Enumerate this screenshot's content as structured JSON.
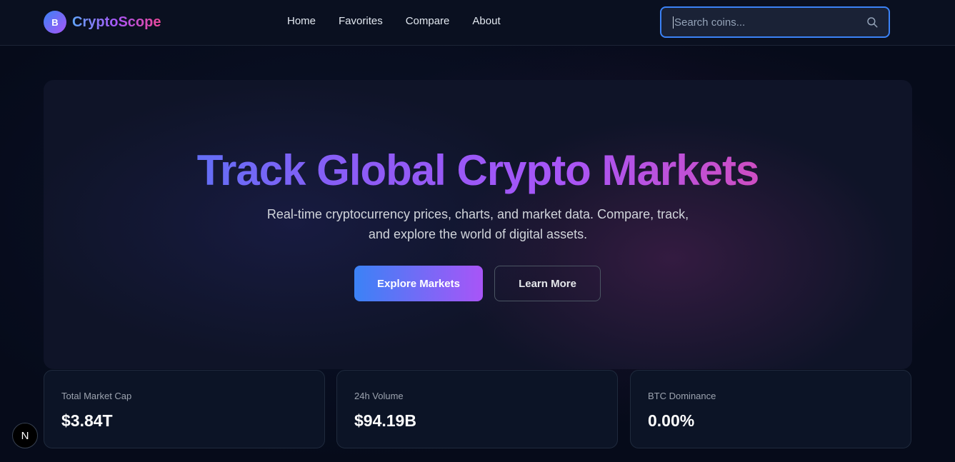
{
  "brand": {
    "logo_glyph": "B",
    "name": "CryptoScope"
  },
  "nav": [
    {
      "label": "Home"
    },
    {
      "label": "Favorites"
    },
    {
      "label": "Compare"
    },
    {
      "label": "About"
    }
  ],
  "search": {
    "placeholder": "Search coins...",
    "value": "",
    "icon": "search-icon"
  },
  "hero": {
    "title": "Track Global Crypto Markets",
    "subtitle_line1": "Real-time cryptocurrency prices, charts, and market data. Compare, track,",
    "subtitle_line2": "and explore the world of digital assets.",
    "primary_button": "Explore Markets",
    "secondary_button": "Learn More"
  },
  "stats": [
    {
      "label": "Total Market Cap",
      "value": "$3.84T"
    },
    {
      "label": "24h Volume",
      "value": "$94.19B"
    },
    {
      "label": "BTC Dominance",
      "value": "0.00%"
    }
  ],
  "badge": {
    "glyph": "N"
  },
  "colors": {
    "background": "#060b1a",
    "accent_blue": "#3b82f6",
    "accent_purple": "#a855f7",
    "accent_pink": "#ec4899"
  }
}
